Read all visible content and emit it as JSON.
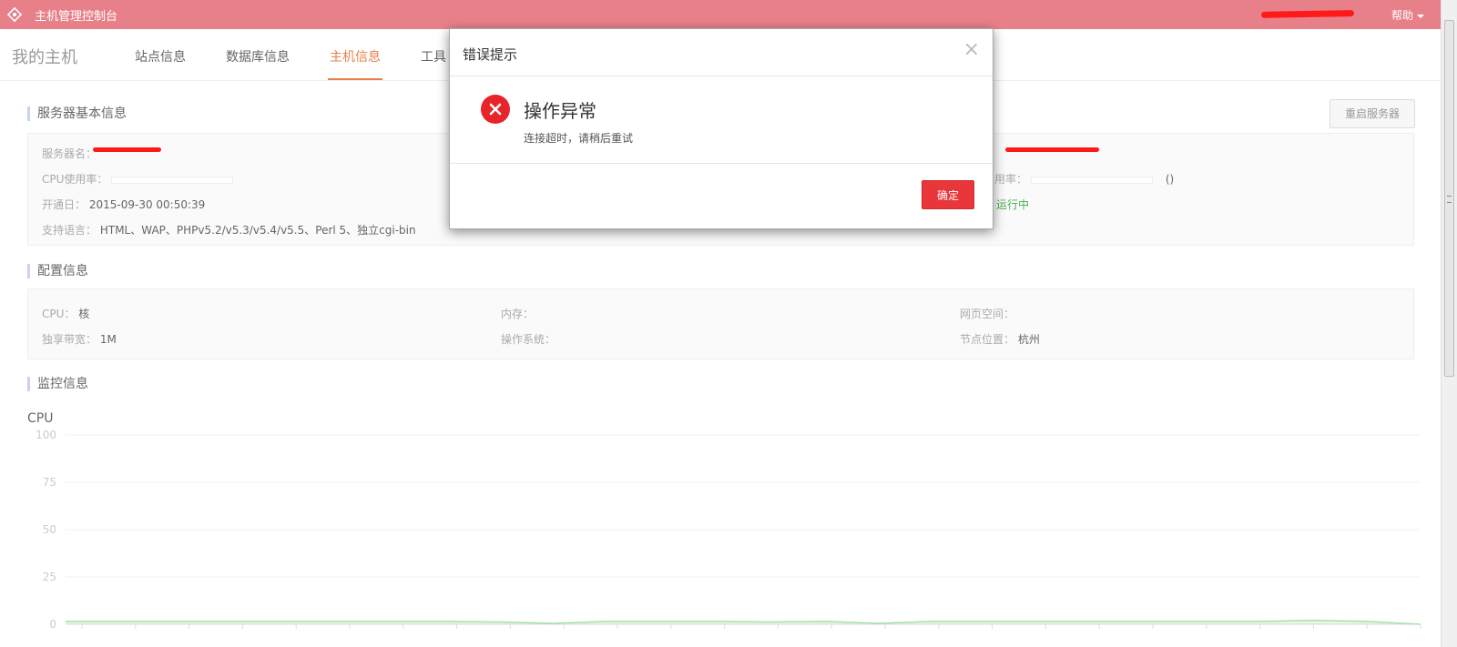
{
  "header": {
    "app_title": "主机管理控制台",
    "help_label": "帮助"
  },
  "nav": {
    "title": "我的主机",
    "tabs": [
      {
        "label": "站点信息"
      },
      {
        "label": "数据库信息"
      },
      {
        "label": "主机信息"
      },
      {
        "label": "工具"
      }
    ],
    "active_tab": "主机信息"
  },
  "basic_info": {
    "section_title": "服务器基本信息",
    "restart_button": "重启服务器",
    "server_name_label": "服务器名：",
    "cpu_usage_label": "CPU使用率：",
    "open_date_label": "开通日：",
    "open_date_value": "2015-09-30 00:50:39",
    "languages_label": "支持语言：",
    "languages_value": "HTML、WAP、PHPv5.2/v5.3/v5.4/v5.5、Perl 5、独立cgi-bin",
    "usage_label_partial": "用率：",
    "usage_value": "()",
    "status_value": "运行中"
  },
  "config_info": {
    "section_title": "配置信息",
    "cpu_label": "CPU：",
    "cpu_value": "核",
    "memory_label": "内存：",
    "webspace_label": "网页空间：",
    "bandwidth_label": "独享带宽：",
    "bandwidth_value": "1M",
    "os_label": "操作系统：",
    "node_label": "节点位置：",
    "node_value": "杭州"
  },
  "monitor": {
    "section_title": "监控信息",
    "chart_title": "CPU"
  },
  "chart_data": {
    "type": "area",
    "title": "CPU",
    "ylim": [
      0,
      100
    ],
    "y_ticks": [
      "100",
      "75",
      "50",
      "25",
      "0"
    ],
    "x_ticks_count": 25,
    "grid": true,
    "series": [
      {
        "color": "#a8e0a8",
        "values": [
          1.5,
          1.5,
          1.5,
          1.5,
          1.5,
          1.5,
          1.5,
          1.5,
          1.2,
          0.5,
          1.5,
          1.5,
          1.5,
          1.2,
          1.5,
          0.5,
          1.5,
          1.5,
          1.5,
          1.5,
          1.5,
          1.5,
          1.5,
          2.0,
          1.5,
          0
        ]
      }
    ]
  },
  "modal": {
    "title": "错误提示",
    "close_glyph": "×",
    "heading": "操作异常",
    "message": "连接超时，请稍后重试",
    "ok_label": "确定"
  },
  "colors": {
    "topbar": "#e8808a",
    "accent": "#e8804a",
    "error": "#e8242b",
    "status_green": "#4caf50"
  }
}
